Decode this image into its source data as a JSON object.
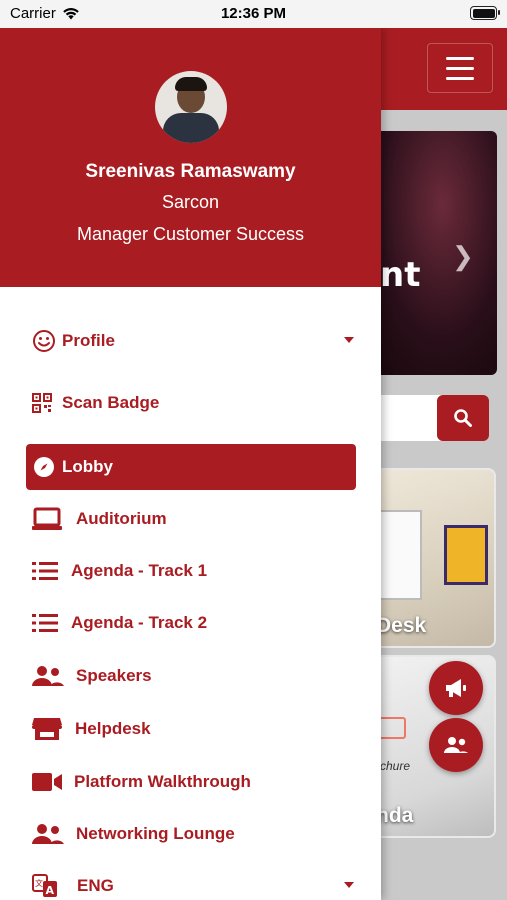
{
  "status_bar": {
    "carrier": "Carrier",
    "time": "12:36 PM"
  },
  "user": {
    "name": "Sreenivas Ramaswamy",
    "company": "Sarcon",
    "role": "Manager Customer Success"
  },
  "menu": [
    {
      "label": "Profile",
      "icon": "smiley-icon",
      "dropdown": true
    },
    {
      "label": "Scan Badge",
      "icon": "qr-code-icon"
    },
    {
      "label": "Lobby",
      "icon": "compass-icon",
      "active": true
    },
    {
      "label": "Auditorium",
      "icon": "laptop-icon"
    },
    {
      "label": "Agenda - Track 1",
      "icon": "list-icon"
    },
    {
      "label": "Agenda - Track 2",
      "icon": "list-icon"
    },
    {
      "label": "Speakers",
      "icon": "users-icon"
    },
    {
      "label": "Helpdesk",
      "icon": "store-icon"
    },
    {
      "label": "Platform Walkthrough",
      "icon": "video-camera-icon"
    },
    {
      "label": "Networking Lounge",
      "icon": "users-icon"
    },
    {
      "label": "ENG",
      "icon": "translate-icon",
      "dropdown": true
    }
  ],
  "background": {
    "hero_text_fragment": "nt",
    "tile1_label": "Desk",
    "tile2_label": "nda",
    "tile2_caption": "chure"
  },
  "colors": {
    "brand": "#a91d22",
    "background": "#c9c9c9"
  }
}
